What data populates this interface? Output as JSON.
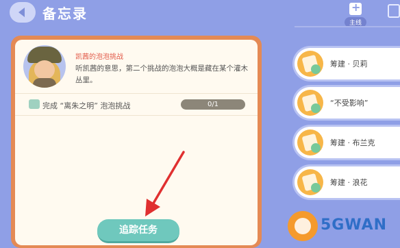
{
  "header": {
    "title": "备忘录",
    "tab_main_label": "主线"
  },
  "quest": {
    "name": "凯茜的泡泡挑战",
    "description": "听凯茜的意思，第二个挑战的泡泡大概是藏在某个灌木丛里。",
    "task_label": "完成 “离朱之明” 泡泡挑战",
    "progress_text": "0/1",
    "track_button": "追踪任务"
  },
  "quest_list": [
    {
      "label": "筹建 · 贝莉"
    },
    {
      "label": "“不受影响”"
    },
    {
      "label": "筹建 · 布兰克"
    },
    {
      "label": "筹建 · 浪花"
    }
  ],
  "watermark": "5GWAN",
  "colors": {
    "background": "#8f9fe6",
    "panel_border": "#e48a55",
    "track_button": "#6fc8bd",
    "arrow": "#e03030"
  }
}
